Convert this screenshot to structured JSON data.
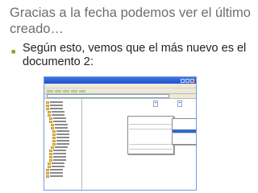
{
  "slide": {
    "title": "Gracias a la fecha podemos ver el último creado…",
    "bullet": "Según esto, vemos que el más nuevo es el documento 2:"
  },
  "explorer": {
    "menu": [
      "Archivo",
      "Edición",
      "Ver",
      "Favoritos",
      "Herramientas",
      "Ayuda"
    ],
    "files": [
      {
        "name": "Documento\n1"
      },
      {
        "name": "Documento\n2"
      }
    ]
  }
}
